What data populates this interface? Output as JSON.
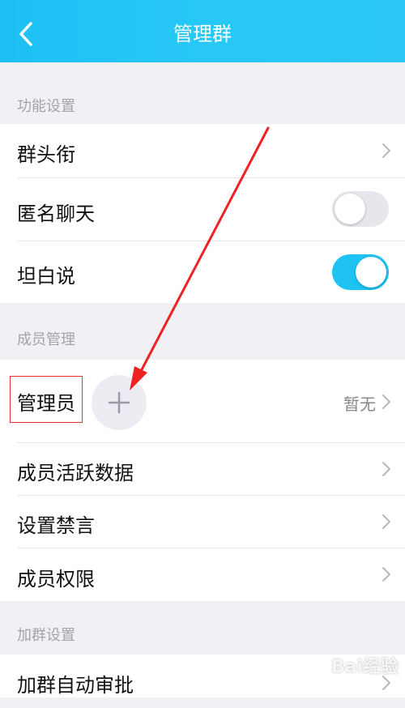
{
  "header": {
    "title": "管理群"
  },
  "sections": {
    "function_settings": {
      "label": "功能设置",
      "items": [
        {
          "label": "群头衔"
        },
        {
          "label": "匿名聊天",
          "toggle": "off"
        },
        {
          "label": "坦白说",
          "toggle": "on"
        }
      ]
    },
    "member_management": {
      "label": "成员管理",
      "admin": {
        "label": "管理员",
        "value": "暂无"
      },
      "items": [
        {
          "label": "成员活跃数据"
        },
        {
          "label": "设置禁言"
        },
        {
          "label": "成员权限"
        }
      ]
    },
    "join_settings": {
      "label": "加群设置",
      "items": [
        {
          "label": "加群自动审批"
        }
      ]
    }
  },
  "watermark": "Bai经验",
  "colors": {
    "header": "#1dc0f4",
    "toggle_on": "#1ec2f3",
    "annotation": "#e33"
  },
  "icons": [
    "back-arrow-icon",
    "chevron-right-icon",
    "add-icon"
  ]
}
